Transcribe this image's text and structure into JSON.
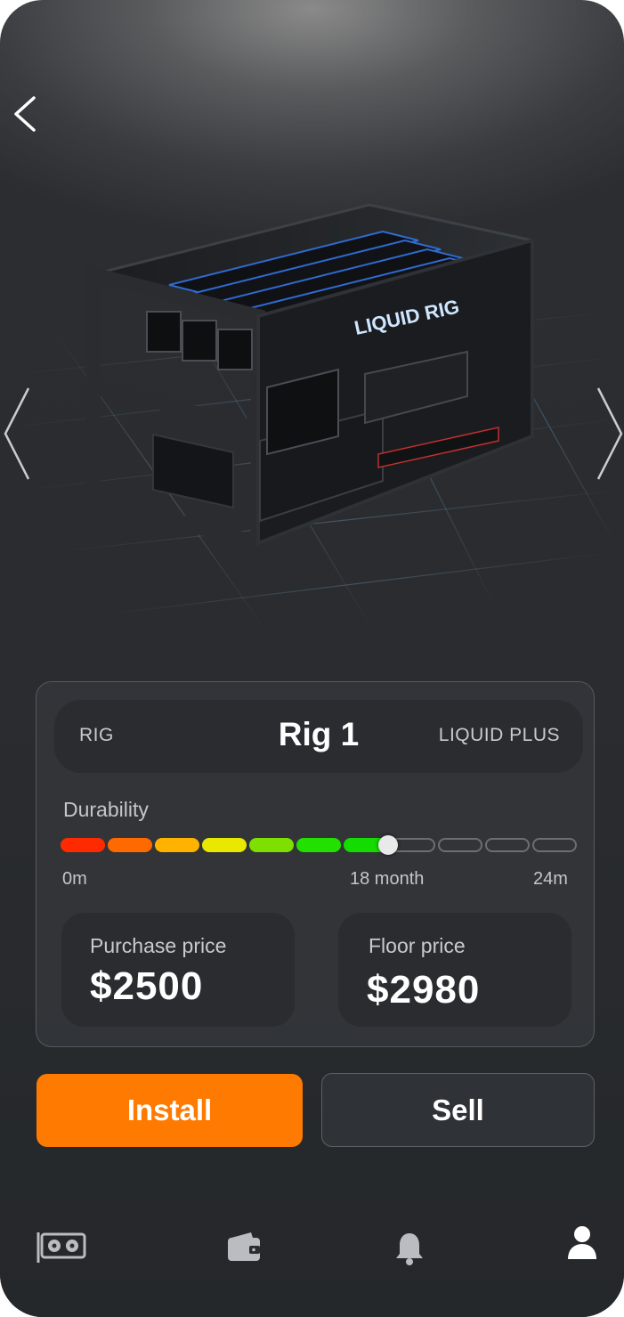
{
  "hero": {
    "rig_sign_text": "LIQUID RIG"
  },
  "card": {
    "type_label": "RIG",
    "title": "Rig 1",
    "model_label": "LIQUID PLUS",
    "durability": {
      "label": "Durability",
      "progress_fraction": 0.68,
      "start_label": "0m",
      "current_label": "18 month",
      "end_label": "24m"
    },
    "purchase": {
      "label": "Purchase price",
      "value": "$2500"
    },
    "floor": {
      "label": "Floor price",
      "value": "$2980"
    }
  },
  "actions": {
    "install_label": "Install",
    "sell_label": "Sell"
  },
  "tabbar": {
    "items": [
      {
        "icon": "gpu-card-icon",
        "active": false
      },
      {
        "icon": "wallet-icon",
        "active": false
      },
      {
        "icon": "bell-icon",
        "active": false
      },
      {
        "icon": "user-icon",
        "active": true
      }
    ]
  },
  "colors": {
    "accent": "#ff7a00",
    "background": "#2b2d30",
    "card": "#2a2c2f",
    "durability_gradient": [
      "#ff2a00",
      "#ff6a00",
      "#ffb300",
      "#e8e800",
      "#7ee000",
      "#22e000",
      "#14dc00",
      "#10d400"
    ]
  }
}
